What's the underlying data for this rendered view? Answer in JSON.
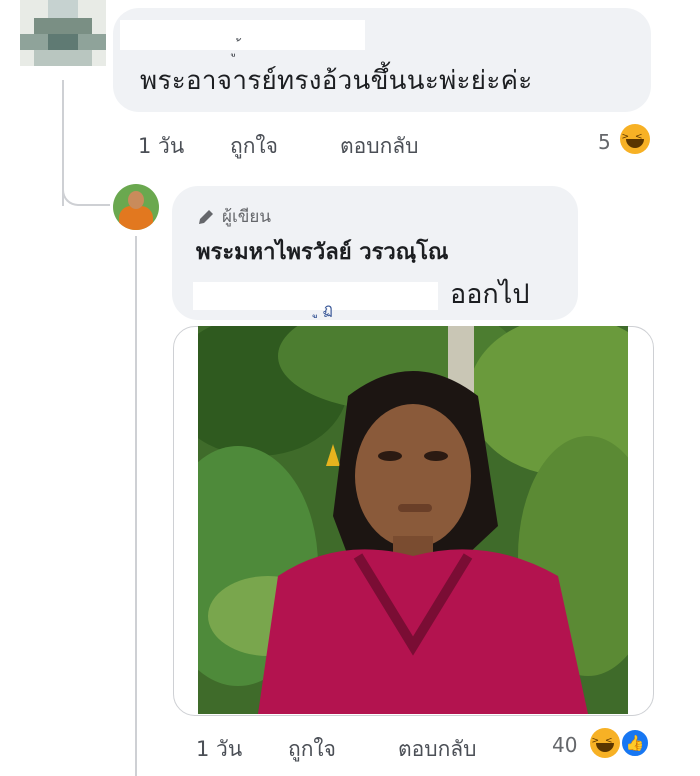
{
  "comment1": {
    "author_fragment": "ู ้",
    "text": "พระอาจารย์ทรงอ้วนขึ้นนะพ่ะย่ะค่ะ",
    "time": "1 วัน",
    "like": "ถูกใจ",
    "reply": "ตอบกลับ",
    "reaction_count": "5",
    "reaction_icon": "laughing-emoji-icon"
  },
  "reply1": {
    "author_badge": "ผู้เขียน",
    "author_name": "พระมหาไพรวัลย์ วรวณฺโณ",
    "redacted_fragment": "ู ฏ",
    "text": "ออกไป",
    "time": "1 วัน",
    "like": "ถูกใจ",
    "reply": "ตอบกลับ",
    "reaction_count": "40",
    "reaction_icons": [
      "laughing-emoji-icon",
      "like-thumb-icon"
    ]
  },
  "colors": {
    "bubble": "#f0f2f5",
    "text": "#1c1e21",
    "muted": "#65676b",
    "like_blue": "#1877f2",
    "emoji_yellow": "#f7b125"
  }
}
